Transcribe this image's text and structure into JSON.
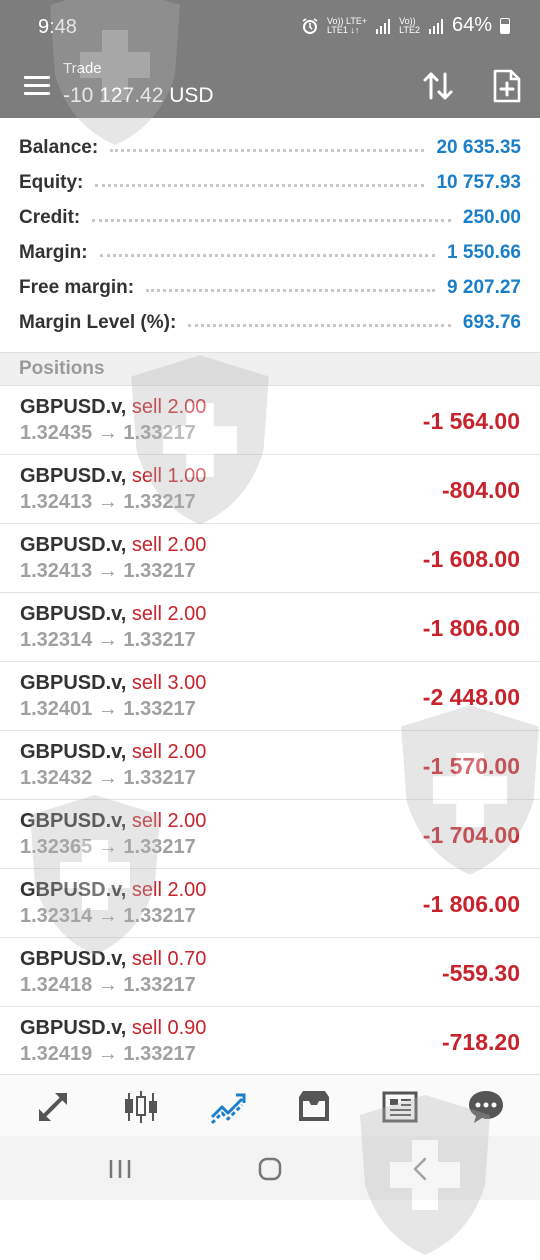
{
  "status_bar": {
    "time": "9:48",
    "signal_line1_top": "Vo))",
    "signal_line1_mid": "LTE+",
    "signal_line1_bot": "LTE1 ↓↑",
    "signal_line2_top": "Vo))",
    "signal_line2_bot": "LTE2",
    "battery": "64%",
    "icons": [
      "alarm-icon",
      "signal-icon",
      "battery-icon"
    ]
  },
  "appbar": {
    "title": "Trade",
    "subtitle": "-10 127.42 USD",
    "icons": [
      "menu-icon",
      "sort-icon",
      "new-order-icon"
    ]
  },
  "summary": [
    {
      "label": "Balance:",
      "value": "20 635.35"
    },
    {
      "label": "Equity:",
      "value": "10 757.93"
    },
    {
      "label": "Credit:",
      "value": "250.00"
    },
    {
      "label": "Margin:",
      "value": "1 550.66"
    },
    {
      "label": "Free margin:",
      "value": "9 207.27"
    },
    {
      "label": "Margin Level (%):",
      "value": "693.76"
    }
  ],
  "positions_header": "Positions",
  "positions": [
    {
      "symbol": "GBPUSD.v,",
      "side": "sell 2.00",
      "prices": "1.32435 → 1.33217",
      "profit": "-1 564.00"
    },
    {
      "symbol": "GBPUSD.v,",
      "side": "sell 1.00",
      "prices": "1.32413 → 1.33217",
      "profit": "-804.00"
    },
    {
      "symbol": "GBPUSD.v,",
      "side": "sell 2.00",
      "prices": "1.32413 → 1.33217",
      "profit": "-1 608.00"
    },
    {
      "symbol": "GBPUSD.v,",
      "side": "sell 2.00",
      "prices": "1.32314 → 1.33217",
      "profit": "-1 806.00"
    },
    {
      "symbol": "GBPUSD.v,",
      "side": "sell 3.00",
      "prices": "1.32401 → 1.33217",
      "profit": "-2 448.00"
    },
    {
      "symbol": "GBPUSD.v,",
      "side": "sell 2.00",
      "prices": "1.32432 → 1.33217",
      "profit": "-1 570.00"
    },
    {
      "symbol": "GBPUSD.v,",
      "side": "sell 2.00",
      "prices": "1.32365 → 1.33217",
      "profit": "-1 704.00"
    },
    {
      "symbol": "GBPUSD.v,",
      "side": "sell 2.00",
      "prices": "1.32314 → 1.33217",
      "profit": "-1 806.00"
    },
    {
      "symbol": "GBPUSD.v,",
      "side": "sell 0.70",
      "prices": "1.32418 → 1.33217",
      "profit": "-559.30"
    },
    {
      "symbol": "GBPUSD.v,",
      "side": "sell 0.90",
      "prices": "1.32419 → 1.33217",
      "profit": "-718.20"
    }
  ],
  "bottom_nav": [
    "quotes-icon",
    "chart-icon",
    "trade-icon",
    "history-icon",
    "news-icon",
    "messages-icon"
  ],
  "system_nav": [
    "recent-apps-icon",
    "home-icon",
    "back-icon"
  ],
  "colors": {
    "header_bg": "#7d7d7d",
    "value_blue": "#1a7ec8",
    "loss_red": "#c8232c",
    "active_nav": "#1a7ec8"
  }
}
